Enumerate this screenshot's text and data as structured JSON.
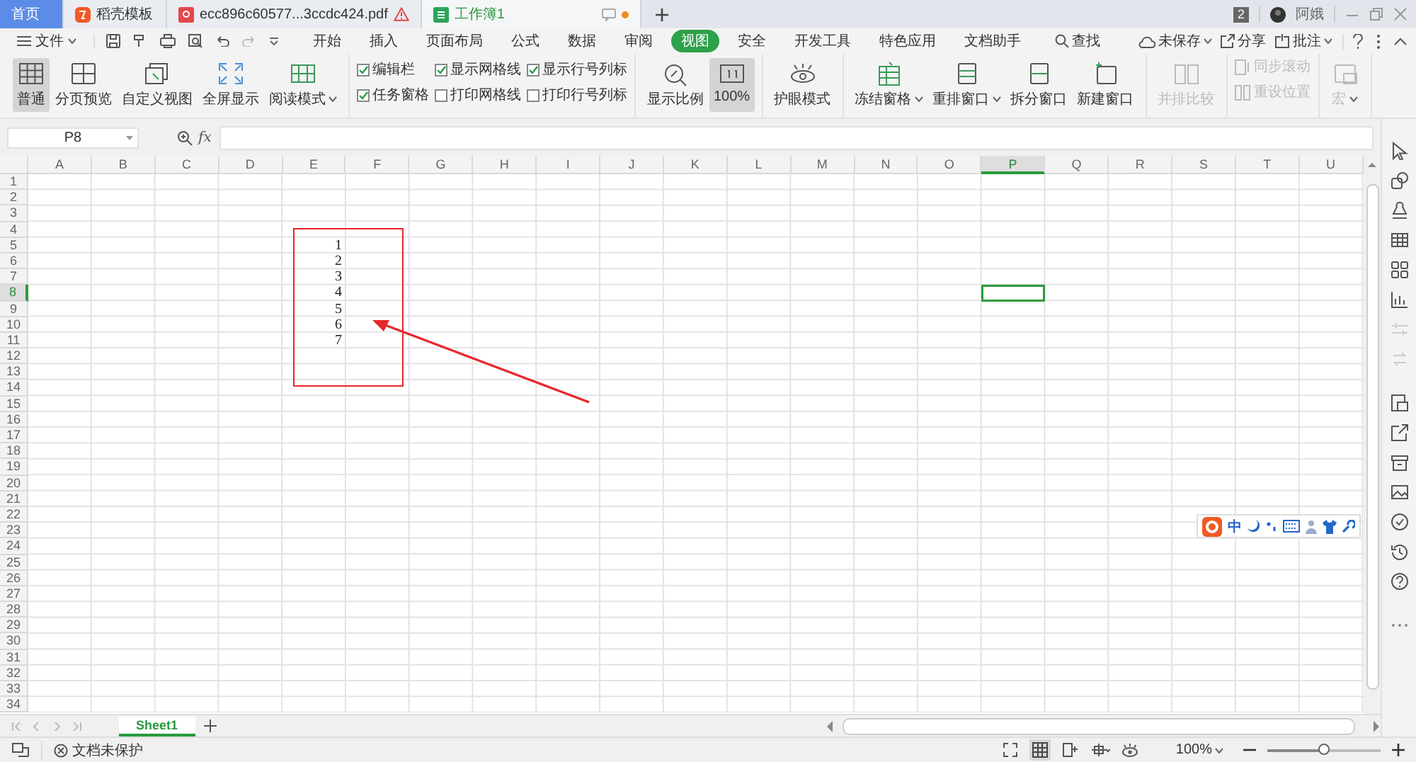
{
  "tabs": [
    {
      "label": "首页",
      "kind": "home",
      "selected": false,
      "warning": false,
      "unsaved": false
    },
    {
      "label": "稻壳模板",
      "kind": "docer",
      "selected": false,
      "warning": false,
      "unsaved": false
    },
    {
      "label": "ecc896c60577...3ccdc424.pdf",
      "kind": "pdf",
      "selected": false,
      "warning": true,
      "unsaved": false
    },
    {
      "label": "工作簿1",
      "kind": "sheet",
      "selected": true,
      "warning": false,
      "unsaved": true
    }
  ],
  "title_bar": {
    "notification_count": "2",
    "user": "阿娥"
  },
  "menu": {
    "file": "文件",
    "tabs": [
      {
        "label": "开始",
        "selected": false
      },
      {
        "label": "插入",
        "selected": false
      },
      {
        "label": "页面布局",
        "selected": false
      },
      {
        "label": "公式",
        "selected": false
      },
      {
        "label": "数据",
        "selected": false
      },
      {
        "label": "审阅",
        "selected": false
      },
      {
        "label": "视图",
        "selected": true
      },
      {
        "label": "安全",
        "selected": false
      },
      {
        "label": "开发工具",
        "selected": false
      },
      {
        "label": "特色应用",
        "selected": false
      },
      {
        "label": "文档助手",
        "selected": false
      }
    ],
    "search": "查找",
    "right": [
      {
        "label": "未保存",
        "dropdown": true
      },
      {
        "label": "分享",
        "dropdown": false
      },
      {
        "label": "批注",
        "dropdown": true
      }
    ]
  },
  "ribbon": [
    {
      "kind": "buttons",
      "items": [
        {
          "label": "普通",
          "selected": true,
          "dropdown": false,
          "disabled": false
        },
        {
          "label": "分页预览",
          "selected": false,
          "dropdown": false,
          "disabled": false
        },
        {
          "label": "自定义视图",
          "selected": false,
          "dropdown": false,
          "disabled": false
        },
        {
          "label": "全屏显示",
          "selected": false,
          "dropdown": false,
          "disabled": false
        },
        {
          "label": "阅读模式",
          "selected": false,
          "dropdown": true,
          "disabled": false
        }
      ]
    },
    {
      "kind": "checks",
      "items": [
        {
          "label": "编辑栏",
          "checked": true
        },
        {
          "label": "任务窗格",
          "checked": true
        },
        {
          "label": "显示网格线",
          "checked": true
        },
        {
          "label": "打印网格线",
          "checked": false
        },
        {
          "label": "显示行号列标",
          "checked": true
        },
        {
          "label": "打印行号列标",
          "checked": false
        }
      ]
    },
    {
      "kind": "buttons",
      "items": [
        {
          "label": "显示比例",
          "selected": false,
          "dropdown": false,
          "disabled": false
        },
        {
          "label": "100%",
          "selected": true,
          "dropdown": false,
          "disabled": false
        }
      ]
    },
    {
      "kind": "buttons",
      "items": [
        {
          "label": "护眼模式",
          "selected": false,
          "dropdown": false,
          "disabled": false
        }
      ]
    },
    {
      "kind": "buttons",
      "items": [
        {
          "label": "冻结窗格",
          "selected": false,
          "dropdown": true,
          "disabled": false
        },
        {
          "label": "重排窗口",
          "selected": false,
          "dropdown": true,
          "disabled": false
        },
        {
          "label": "拆分窗口",
          "selected": false,
          "dropdown": false,
          "disabled": false
        },
        {
          "label": "新建窗口",
          "selected": false,
          "dropdown": false,
          "disabled": false
        }
      ]
    },
    {
      "kind": "buttons",
      "items": [
        {
          "label": "并排比较",
          "selected": false,
          "dropdown": false,
          "disabled": true
        }
      ]
    },
    {
      "kind": "small",
      "items": [
        {
          "label": "同步滚动",
          "disabled": true
        },
        {
          "label": "重设位置",
          "disabled": true
        }
      ]
    },
    {
      "kind": "buttons",
      "items": [
        {
          "label": "宏",
          "selected": false,
          "dropdown": true,
          "disabled": true
        }
      ]
    }
  ],
  "formula_bar": {
    "name_box": "P8",
    "fx": "fx"
  },
  "grid": {
    "columns": [
      {
        "label": "A",
        "selected": false
      },
      {
        "label": "B",
        "selected": false
      },
      {
        "label": "C",
        "selected": false
      },
      {
        "label": "D",
        "selected": false
      },
      {
        "label": "E",
        "selected": false,
        "cells": [
          "1",
          "2",
          "3",
          "4",
          "5",
          "6",
          "7"
        ]
      },
      {
        "label": "F",
        "selected": false
      },
      {
        "label": "G",
        "selected": false
      },
      {
        "label": "H",
        "selected": false
      },
      {
        "label": "I",
        "selected": false
      },
      {
        "label": "J",
        "selected": false
      },
      {
        "label": "K",
        "selected": false
      },
      {
        "label": "L",
        "selected": false
      },
      {
        "label": "M",
        "selected": false
      },
      {
        "label": "N",
        "selected": false
      },
      {
        "label": "O",
        "selected": false
      },
      {
        "label": "P",
        "selected": true
      },
      {
        "label": "Q",
        "selected": false
      },
      {
        "label": "R",
        "selected": false
      },
      {
        "label": "S",
        "selected": false
      },
      {
        "label": "T",
        "selected": false
      },
      {
        "label": "U",
        "selected": false
      }
    ],
    "rows": [
      {
        "label": "1",
        "selected": false
      },
      {
        "label": "2",
        "selected": false
      },
      {
        "label": "3",
        "selected": false
      },
      {
        "label": "4",
        "selected": false
      },
      {
        "label": "5",
        "selected": false
      },
      {
        "label": "6",
        "selected": false
      },
      {
        "label": "7",
        "selected": false
      },
      {
        "label": "8",
        "selected": true
      },
      {
        "label": "9",
        "selected": false
      },
      {
        "label": "10",
        "selected": false
      },
      {
        "label": "11",
        "selected": false
      },
      {
        "label": "12",
        "selected": false
      },
      {
        "label": "13",
        "selected": false
      },
      {
        "label": "14",
        "selected": false
      },
      {
        "label": "15",
        "selected": false
      },
      {
        "label": "16",
        "selected": false
      },
      {
        "label": "17",
        "selected": false
      },
      {
        "label": "18",
        "selected": false
      },
      {
        "label": "19",
        "selected": false
      },
      {
        "label": "20",
        "selected": false
      },
      {
        "label": "21",
        "selected": false
      },
      {
        "label": "22",
        "selected": false
      },
      {
        "label": "23",
        "selected": false
      },
      {
        "label": "24",
        "selected": false
      },
      {
        "label": "25",
        "selected": false
      },
      {
        "label": "26",
        "selected": false
      },
      {
        "label": "27",
        "selected": false
      },
      {
        "label": "28",
        "selected": false
      },
      {
        "label": "29",
        "selected": false
      },
      {
        "label": "30",
        "selected": false
      },
      {
        "label": "31",
        "selected": false
      },
      {
        "label": "32",
        "selected": false
      },
      {
        "label": "33",
        "selected": false
      },
      {
        "label": "34",
        "selected": false
      }
    ],
    "annotations": {
      "box": true,
      "arrow": true
    }
  },
  "ime_toolbar": {
    "mode": "中"
  },
  "sheet_tabs": [
    {
      "label": "Sheet1",
      "selected": true
    }
  ],
  "status_bar": {
    "protection": "文档未保护",
    "zoom": "100%",
    "zoom_slider": {
      "level": 0.5
    }
  }
}
